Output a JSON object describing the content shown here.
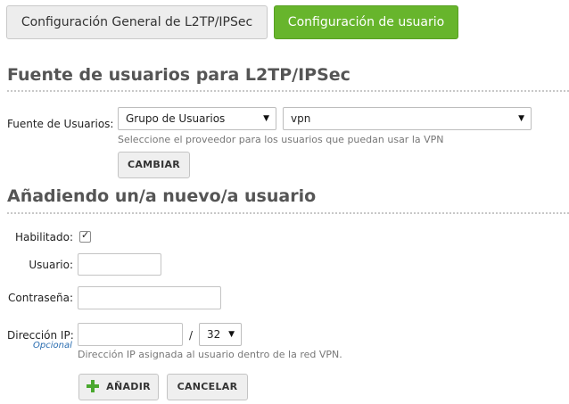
{
  "tabs": {
    "general_label": "Configuración General de L2TP/IPSec",
    "users_label": "Configuración de usuario"
  },
  "source_section": {
    "title": "Fuente de usuarios para L2TP/IPSec",
    "field_label": "Fuente de Usuarios:",
    "provider_select": {
      "selected": "Grupo de Usuarios"
    },
    "group_select": {
      "selected": "vpn"
    },
    "hint": "Seleccione el proveedor para los usuarios que puedan usar la VPN",
    "change_button": "CAMBIAR"
  },
  "add_user_section": {
    "title": "Añadiendo un/a nuevo/a usuario",
    "enabled_label": "Habilitado:",
    "enabled_checked": true,
    "user_label": "Usuario:",
    "user_value": "",
    "password_label": "Contraseña:",
    "password_value": "",
    "ip_label": "Dirección IP:",
    "ip_optional": "Opcional",
    "ip_value": "",
    "slash": "/",
    "mask_select": {
      "selected": "32"
    },
    "ip_hint": "Dirección IP asignada al usuario dentro de la red VPN.",
    "add_button": "AÑADIR",
    "cancel_button": "CANCELAR"
  },
  "colors": {
    "accent": "#67b52c",
    "link": "#2a6db0",
    "plus_icon": "#4aa82f"
  },
  "icons": {
    "dropdown": "chevron-down-icon",
    "add": "plus-icon",
    "checkbox": "checkmark-icon"
  }
}
